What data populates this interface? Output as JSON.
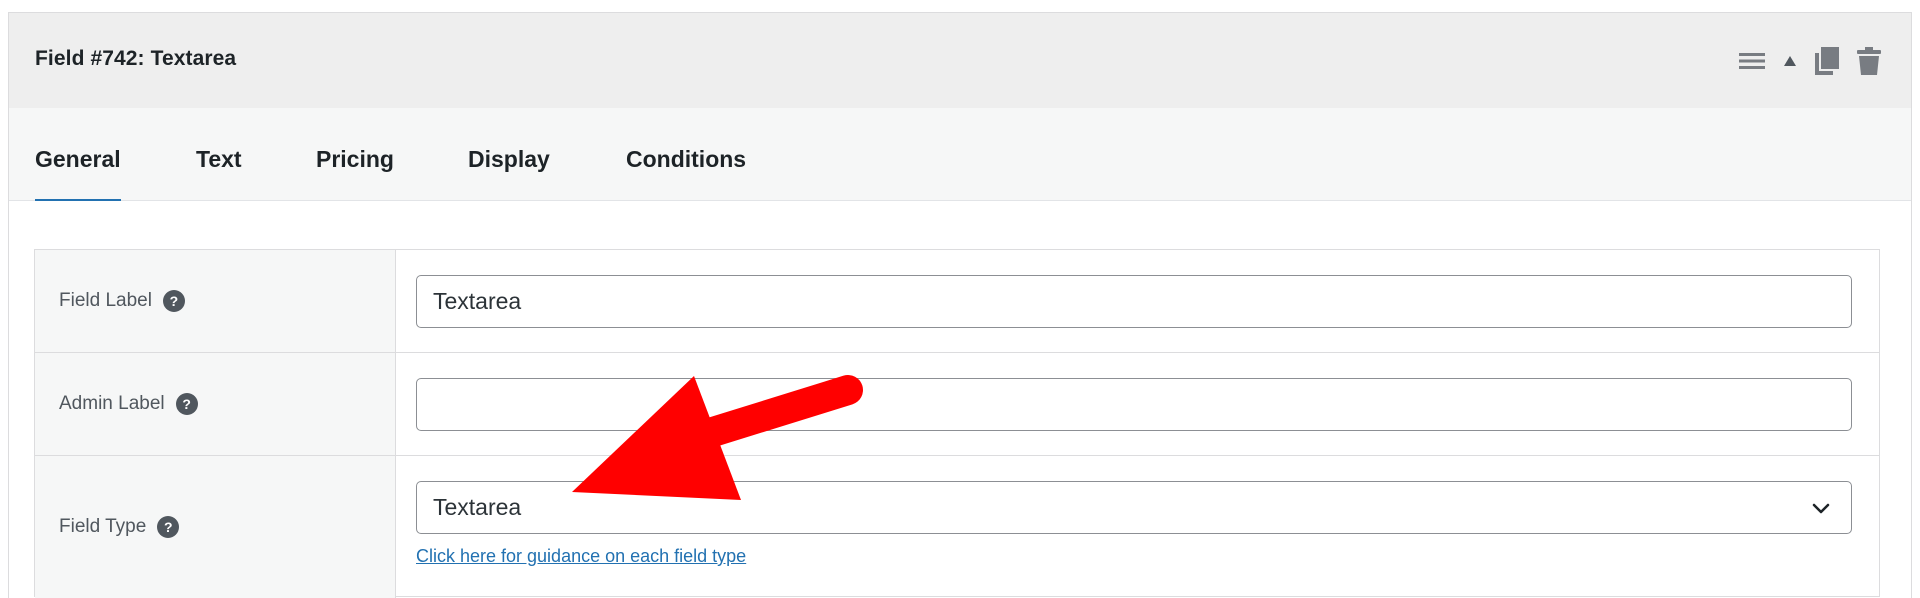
{
  "panel": {
    "title": "Field #742: Textarea",
    "actions": [
      {
        "icon": "menu-lines-icon",
        "label": ""
      },
      {
        "icon": "triangle-up-icon",
        "label": ""
      },
      {
        "icon": "duplicate-icon",
        "label": ""
      },
      {
        "icon": "trash-icon",
        "label": ""
      }
    ]
  },
  "tabs": [
    {
      "label": "General",
      "active": true
    },
    {
      "label": "Text",
      "active": false
    },
    {
      "label": "Pricing",
      "active": false
    },
    {
      "label": "Display",
      "active": false
    },
    {
      "label": "Conditions",
      "active": false
    }
  ],
  "form": {
    "field_label": {
      "label": "Field Label",
      "value": "Textarea",
      "placeholder": ""
    },
    "admin_label": {
      "label": "Admin Label",
      "value": "",
      "placeholder": ""
    },
    "field_type": {
      "label": "Field Type",
      "selected": "Textarea",
      "guidance_link": "Click here for guidance on each field type"
    },
    "help_glyph": "?"
  },
  "annotation": {
    "color": "#ff0000",
    "type": "arrow"
  },
  "colors": {
    "accent": "#2271b1",
    "header_bg": "#eeeeee",
    "tabs_bg": "#f6f7f7"
  }
}
